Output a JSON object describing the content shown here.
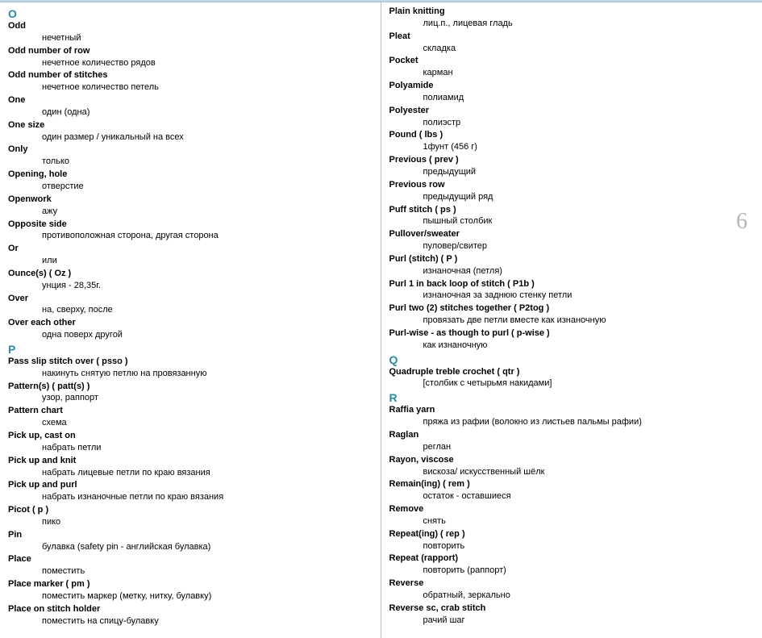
{
  "pageNumber": "6",
  "left": {
    "sections": [
      {
        "letter": "O",
        "entries": [
          {
            "term": "Odd",
            "def": "нечетный"
          },
          {
            "term": "Odd number of row",
            "def": "нечетное количество рядов"
          },
          {
            "term": "Odd number of stitches",
            "def": "нечетное количество петель"
          },
          {
            "term": "One",
            "def": "один (одна)"
          },
          {
            "term": "One size",
            "def": "один размер / уникальный на всех"
          },
          {
            "term": "Only",
            "def": "только"
          },
          {
            "term": "Opening, hole",
            "def": "отверстие"
          },
          {
            "term": "Openwork",
            "def": "ажу"
          },
          {
            "term": "Opposite side",
            "def": "противоположная сторона, другая сторона"
          },
          {
            "term": "Or",
            "def": "или"
          },
          {
            "term": "Ounce(s) ( Oz )",
            "def": "унция - 28,35г."
          },
          {
            "term": "Over",
            "def": "на, сверху, после"
          },
          {
            "term": "Over each other",
            "def": "одна поверх другой"
          }
        ]
      },
      {
        "letter": "P",
        "entries": [
          {
            "term": "Pass slip stitch over ( psso )",
            "def": "накинуть снятую петлю на провязанную"
          },
          {
            "term": "Pattern(s) ( patt(s) )",
            "def": "узор, раппорт"
          },
          {
            "term": "Pattern chart",
            "def": "схема"
          },
          {
            "term": "Pick up, cast on",
            "def": "набрать петли"
          },
          {
            "term": "Pick up and knit",
            "def": "набрать лицевые петли по краю вязания"
          },
          {
            "term": "Pick up and purl",
            "def": "набрать изнаночные петли по краю вязания"
          },
          {
            "term": "Picot ( p )",
            "def": "пико"
          },
          {
            "term": "Pin",
            "def": "булавка (safety pin - английская булавка)"
          },
          {
            "term": "Place",
            "def": "поместить"
          },
          {
            "term": "Place marker ( pm )",
            "def": "поместить маркер (метку, нитку, булавку)"
          },
          {
            "term": "Place on stitch holder",
            "def": "поместить на спицу-булавку"
          }
        ]
      }
    ]
  },
  "right": {
    "sections": [
      {
        "letter": "",
        "entries": [
          {
            "term": "Plain knitting",
            "def": "лиц.п., лицевая гладь"
          },
          {
            "term": "Pleat",
            "def": "складка"
          },
          {
            "term": "Pocket",
            "def": "карман"
          },
          {
            "term": "Polyamide",
            "def": "полиамид"
          },
          {
            "term": "Polyester",
            "def": "полиэстр"
          },
          {
            "term": "Pound ( lbs )",
            "def": "1фунт (456 г)"
          },
          {
            "term": "Previous ( prev )",
            "def": "предыдущий"
          },
          {
            "term": "Previous row",
            "def": "предыдущий ряд"
          },
          {
            "term": "Puff stitch ( ps )",
            "def": "пышный столбик"
          },
          {
            "term": "Pullover/sweater",
            "def": "пуловер/свитер"
          },
          {
            "term": "Purl (stitch) ( P )",
            "def": "изнаночная (петля)"
          },
          {
            "term": "Purl 1 in back loop of stitch ( P1b )",
            "def": "изнаночная за заднюю стенку петли"
          },
          {
            "term": "Purl two (2) stitches together ( P2tog )",
            "def": "провязать две петли вместе как изнаночную"
          },
          {
            "term": "Purl-wise - as though to purl ( p-wise )",
            "def": "как изнаночную"
          }
        ]
      },
      {
        "letter": "Q",
        "entries": [
          {
            "term": "Quadruple treble crochet ( qtr )",
            "def": "[столбик с четырьмя накидами]"
          }
        ]
      },
      {
        "letter": "R",
        "entries": [
          {
            "term": "Raffia yarn",
            "def": "пряжа из рафии (волокно из листьев пальмы рафии)"
          },
          {
            "term": "Raglan",
            "def": "реглан"
          },
          {
            "term": "Rayon, viscose",
            "def": "вискоза/ искусственный шёлк"
          },
          {
            "term": "Remain(ing) ( rem )",
            "def": "остаток - оставшиеся"
          },
          {
            "term": "Remove",
            "def": "снять"
          },
          {
            "term": "Repeat(ing) ( rep )",
            "def": "повторить"
          },
          {
            "term": "Repeat (rapport)",
            "def": "повторить (раппорт)"
          },
          {
            "term": "Reverse",
            "def": "обратный, зеркально"
          },
          {
            "term": "Reverse sc, crab stitch",
            "def": "рачий шаг"
          }
        ]
      }
    ]
  }
}
